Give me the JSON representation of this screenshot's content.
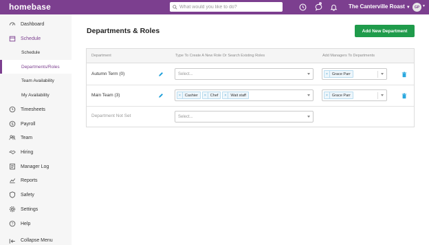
{
  "brand": {
    "logo": "homebase",
    "accent": "#7c3f8f",
    "button_green": "#1f9b4b"
  },
  "topbar": {
    "search_placeholder": "What would you like to do?",
    "company": "The Canterville Roast",
    "avatar_initials": "GP",
    "icons": [
      "clock-icon",
      "chat-icon",
      "bell-icon"
    ]
  },
  "sidebar": {
    "items": [
      {
        "label": "Dashboard",
        "icon": "dashboard-icon"
      },
      {
        "label": "Schedule",
        "icon": "calendar-icon"
      },
      {
        "label": "Schedule"
      },
      {
        "label": "Departments/Roles"
      },
      {
        "label": "Team Availability"
      },
      {
        "label": "My Availability"
      },
      {
        "label": "Timesheets",
        "icon": "clock-icon"
      },
      {
        "label": "Payroll",
        "icon": "dollar-icon"
      },
      {
        "label": "Team",
        "icon": "team-icon"
      },
      {
        "label": "Hiring",
        "icon": "handshake-icon"
      },
      {
        "label": "Manager Log",
        "icon": "log-icon"
      },
      {
        "label": "Reports",
        "icon": "chart-icon"
      },
      {
        "label": "Safety",
        "icon": "shield-icon"
      },
      {
        "label": "Settings",
        "icon": "gear-icon"
      },
      {
        "label": "Help",
        "icon": "help-icon"
      }
    ],
    "collapse_label": "Collapse Menu"
  },
  "main": {
    "title": "Departments & Roles",
    "add_button": "Add New Department",
    "columns": {
      "department": "Department",
      "roles": "Type To Create A New Role Or Search Existing Roles",
      "managers": "Add Managers To Departments"
    },
    "rows": [
      {
        "name": "Autumn Term (0)",
        "roles_placeholder": "Select...",
        "roles": [],
        "managers": [
          "Grace Parr"
        ]
      },
      {
        "name": "Main Team (3)",
        "roles_placeholder": "",
        "roles": [
          "Cashier",
          "Chef",
          "Wait staff"
        ],
        "managers": [
          "Grace Parr"
        ]
      },
      {
        "name": "Department Not Set",
        "roles_placeholder": "Select...",
        "roles": [],
        "managers": []
      }
    ]
  }
}
